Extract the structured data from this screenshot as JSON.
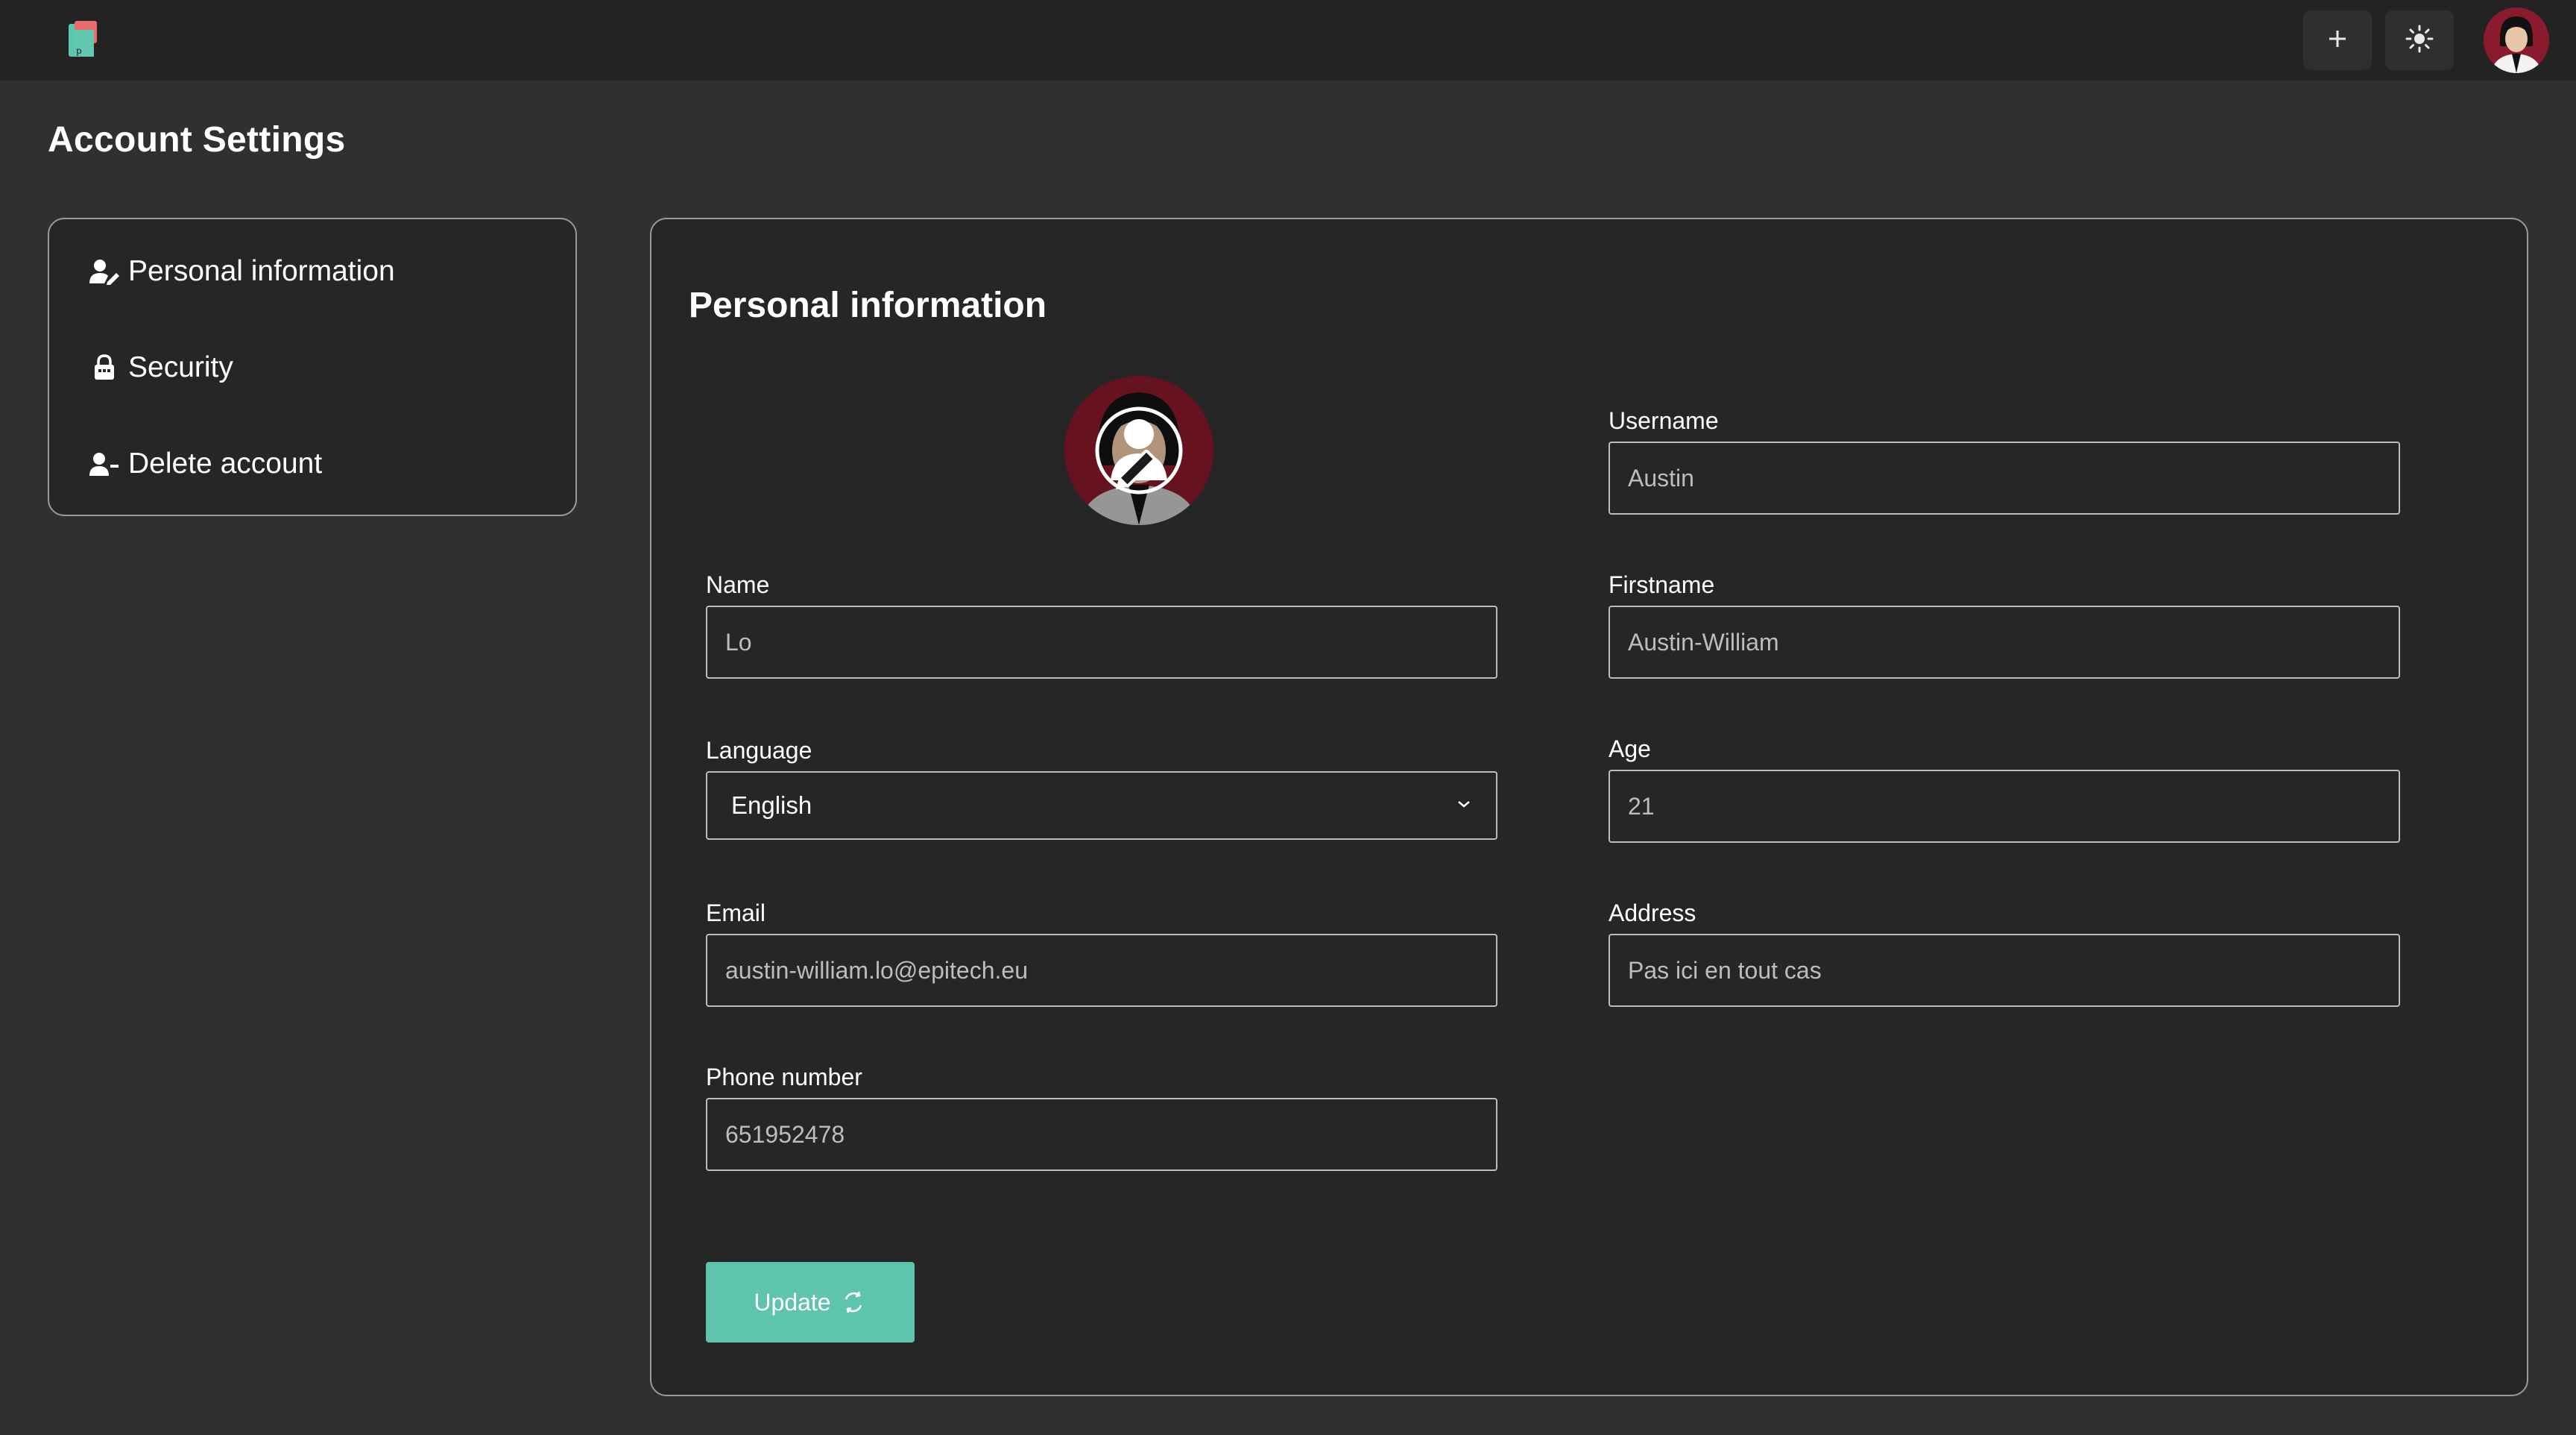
{
  "topbar": {
    "logo_name": "app-logo",
    "add_icon": "plus-icon",
    "theme_icon": "sun-icon"
  },
  "page": {
    "title": "Account Settings"
  },
  "sidebar": {
    "items": [
      {
        "label": "Personal information",
        "icon": "user-edit-icon"
      },
      {
        "label": "Security",
        "icon": "lock-icon"
      },
      {
        "label": "Delete account",
        "icon": "user-minus-icon"
      }
    ]
  },
  "form": {
    "title": "Personal information",
    "fields": {
      "username": {
        "label": "Username",
        "placeholder": "Austin"
      },
      "name": {
        "label": "Name",
        "placeholder": "Lo"
      },
      "firstname": {
        "label": "Firstname",
        "placeholder": "Austin-William"
      },
      "language": {
        "label": "Language",
        "value": "English"
      },
      "age": {
        "label": "Age",
        "placeholder": "21"
      },
      "email": {
        "label": "Email",
        "placeholder": "austin-william.lo@epitech.eu"
      },
      "address": {
        "label": "Address",
        "placeholder": "Pas ici en tout cas"
      },
      "phone": {
        "label": "Phone number",
        "placeholder": "651952478"
      }
    },
    "update_label": "Update"
  },
  "colors": {
    "background": "#303030",
    "topbar": "#232323",
    "panel": "#262626",
    "accent": "#5fc4ad",
    "avatar_bg": "#8a1a2c"
  }
}
